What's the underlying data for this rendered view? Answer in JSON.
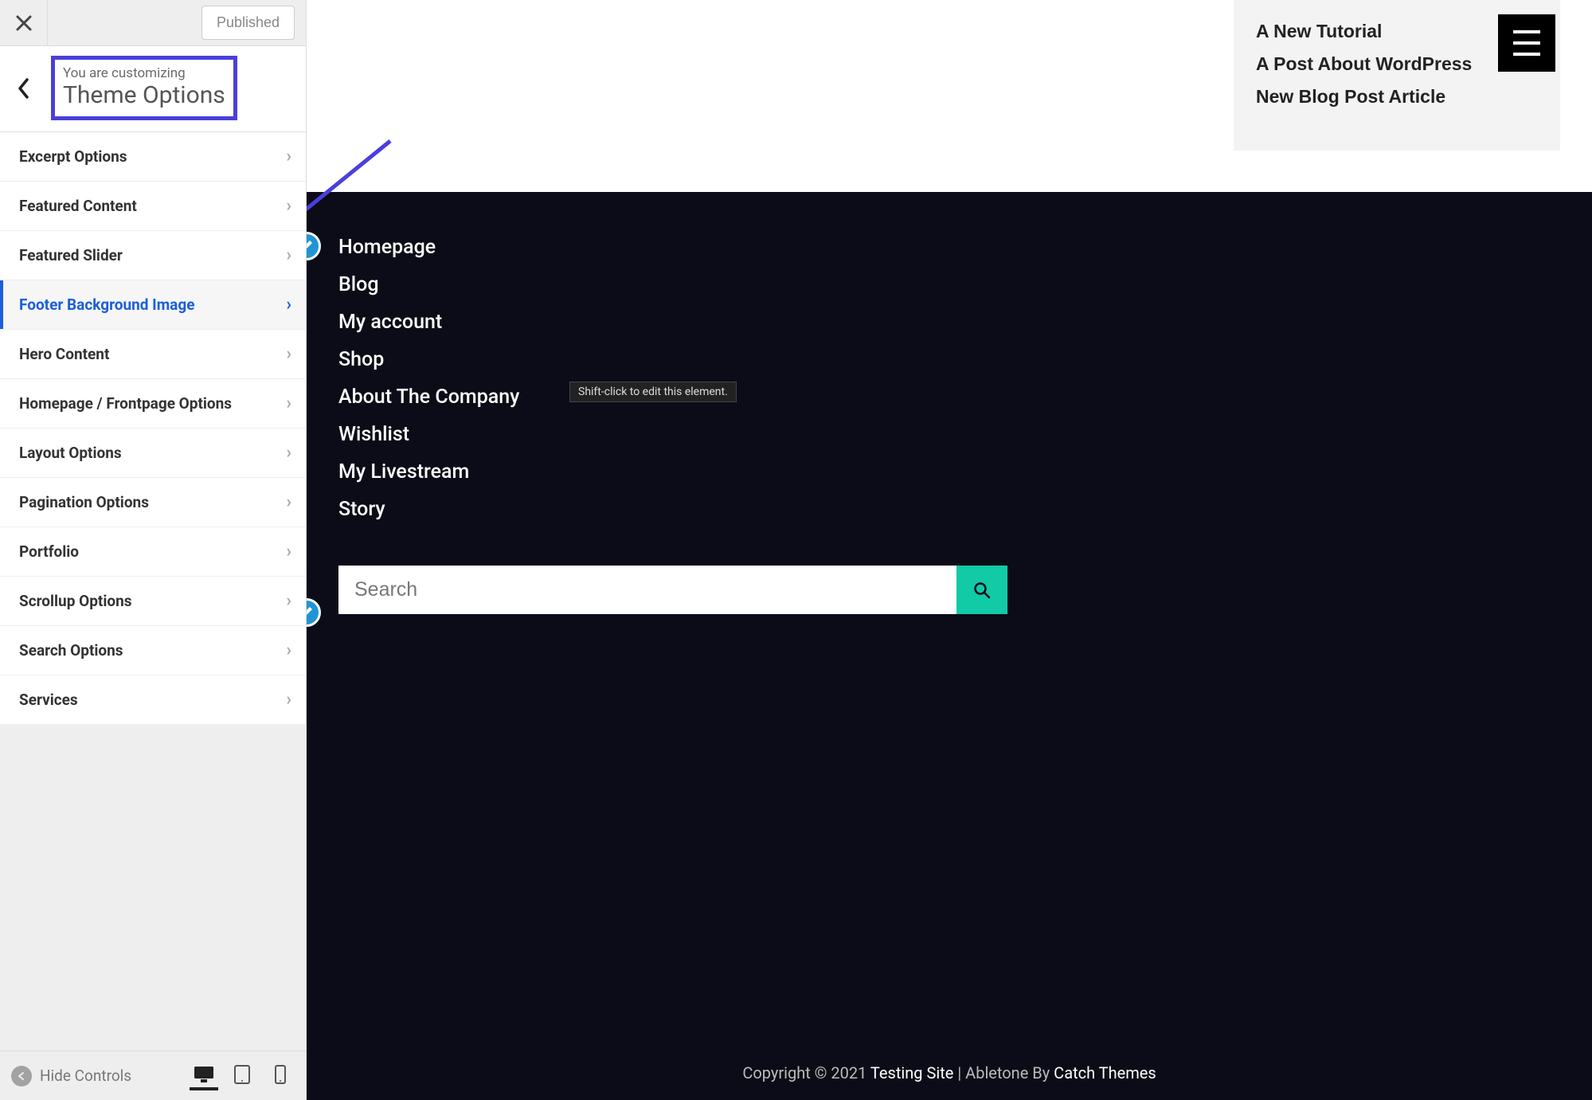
{
  "topbar": {
    "published_label": "Published"
  },
  "panel": {
    "customizing_label": "You are customizing",
    "title": "Theme Options"
  },
  "options": [
    {
      "label": "Excerpt Options",
      "selected": false
    },
    {
      "label": "Featured Content",
      "selected": false
    },
    {
      "label": "Featured Slider",
      "selected": false
    },
    {
      "label": "Footer Background Image",
      "selected": true
    },
    {
      "label": "Hero Content",
      "selected": false
    },
    {
      "label": "Homepage / Frontpage Options",
      "selected": false
    },
    {
      "label": "Layout Options",
      "selected": false
    },
    {
      "label": "Pagination Options",
      "selected": false
    },
    {
      "label": "Portfolio",
      "selected": false
    },
    {
      "label": "Scrollup Options",
      "selected": false
    },
    {
      "label": "Search Options",
      "selected": false
    },
    {
      "label": "Services",
      "selected": false
    }
  ],
  "bottom": {
    "hide_label": "Hide Controls"
  },
  "preview": {
    "recent_posts": [
      "A New Tutorial",
      "A Post About WordPress",
      "New Blog Post Article"
    ],
    "footer_nav": [
      "Homepage",
      "Blog",
      "My account",
      "Shop",
      "About The Company",
      "Wishlist",
      "My Livestream",
      "Story"
    ],
    "tooltip": "Shift-click to edit this element.",
    "search_placeholder": "Search",
    "copyright_prefix": "Copyright © 2021 ",
    "site_name": "Testing Site",
    "theme_sep": " | Abletone By ",
    "theme_author": "Catch Themes"
  }
}
